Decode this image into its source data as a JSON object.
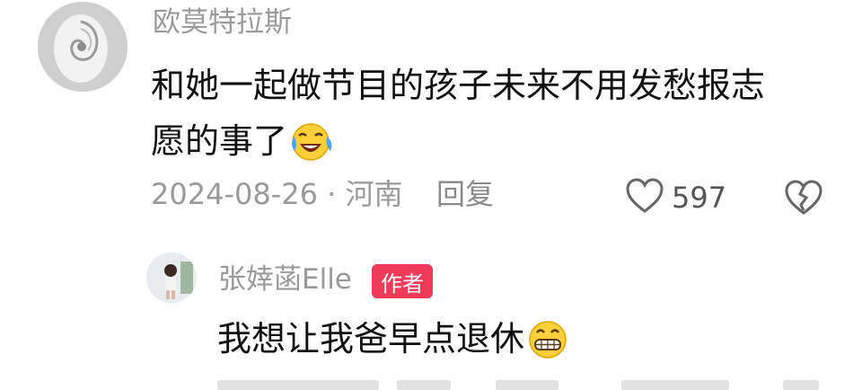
{
  "comment": {
    "username": "欧莫特拉斯",
    "text_line1": "和她一起做节目的孩子未来不用发愁报志",
    "text_line2": "愿的事了",
    "emoji": "laughing-crying-face",
    "date": "2024-08-26",
    "location": "河南",
    "separator": "·",
    "reply_label": "回复",
    "like_count": "597"
  },
  "reply": {
    "username": "张婞菡Elle",
    "author_badge": "作者",
    "text": "我想让我爸早点退休",
    "emoji": "grinning-face"
  },
  "colors": {
    "badge": "#f03a5a",
    "meta_text": "#9a9a9a",
    "body_text": "#111111"
  }
}
